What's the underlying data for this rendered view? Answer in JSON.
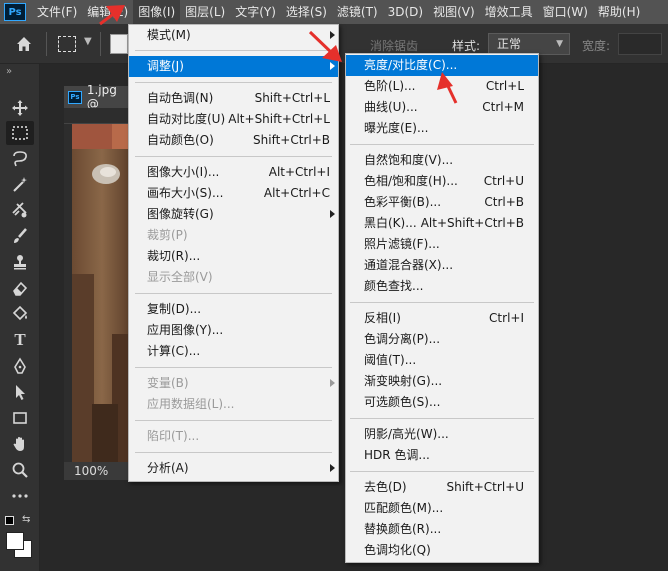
{
  "menubar": {
    "logo": "Ps",
    "items": [
      "文件(F)",
      "编辑(E)",
      "图像(I)",
      "图层(L)",
      "文字(Y)",
      "选择(S)",
      "滤镜(T)",
      "3D(D)",
      "视图(V)",
      "增效工具",
      "窗口(W)",
      "帮助(H)"
    ]
  },
  "options": {
    "antialias": "消除锯齿",
    "style_label": "样式:",
    "style_value": "正常",
    "width_label": "宽度:"
  },
  "document": {
    "tab_title": "1.jpg @",
    "zoom": "100%"
  },
  "image_menu": {
    "items": [
      {
        "label": "模式(M)",
        "shortcut": "",
        "submenu": true,
        "disabled": false
      },
      {
        "label": "调整(J)",
        "shortcut": "",
        "submenu": true,
        "disabled": false,
        "highlighted": true
      },
      {
        "label": "自动色调(N)",
        "shortcut": "Shift+Ctrl+L",
        "disabled": false
      },
      {
        "label": "自动对比度(U)",
        "shortcut": "Alt+Shift+Ctrl+L",
        "disabled": false
      },
      {
        "label": "自动颜色(O)",
        "shortcut": "Shift+Ctrl+B",
        "disabled": false
      },
      {
        "label": "图像大小(I)...",
        "shortcut": "Alt+Ctrl+I",
        "disabled": false
      },
      {
        "label": "画布大小(S)...",
        "shortcut": "Alt+Ctrl+C",
        "disabled": false
      },
      {
        "label": "图像旋转(G)",
        "shortcut": "",
        "submenu": true,
        "disabled": false
      },
      {
        "label": "裁剪(P)",
        "shortcut": "",
        "disabled": true
      },
      {
        "label": "裁切(R)...",
        "shortcut": "",
        "disabled": false
      },
      {
        "label": "显示全部(V)",
        "shortcut": "",
        "disabled": true
      },
      {
        "label": "复制(D)...",
        "shortcut": "",
        "disabled": false
      },
      {
        "label": "应用图像(Y)...",
        "shortcut": "",
        "disabled": false
      },
      {
        "label": "计算(C)...",
        "shortcut": "",
        "disabled": false
      },
      {
        "label": "变量(B)",
        "shortcut": "",
        "submenu": true,
        "disabled": true
      },
      {
        "label": "应用数据组(L)...",
        "shortcut": "",
        "disabled": true
      },
      {
        "label": "陷印(T)...",
        "shortcut": "",
        "disabled": true
      },
      {
        "label": "分析(A)",
        "shortcut": "",
        "submenu": true,
        "disabled": false
      }
    ]
  },
  "adjust_menu": {
    "items": [
      {
        "label": "亮度/对比度(C)...",
        "shortcut": "",
        "highlighted": true
      },
      {
        "label": "色阶(L)...",
        "shortcut": "Ctrl+L"
      },
      {
        "label": "曲线(U)...",
        "shortcut": "Ctrl+M"
      },
      {
        "label": "曝光度(E)...",
        "shortcut": ""
      },
      {
        "label": "自然饱和度(V)...",
        "shortcut": ""
      },
      {
        "label": "色相/饱和度(H)...",
        "shortcut": "Ctrl+U"
      },
      {
        "label": "色彩平衡(B)...",
        "shortcut": "Ctrl+B"
      },
      {
        "label": "黑白(K)...",
        "shortcut": "Alt+Shift+Ctrl+B"
      },
      {
        "label": "照片滤镜(F)...",
        "shortcut": ""
      },
      {
        "label": "通道混合器(X)...",
        "shortcut": ""
      },
      {
        "label": "颜色查找...",
        "shortcut": ""
      },
      {
        "label": "反相(I)",
        "shortcut": "Ctrl+I"
      },
      {
        "label": "色调分离(P)...",
        "shortcut": ""
      },
      {
        "label": "阈值(T)...",
        "shortcut": ""
      },
      {
        "label": "渐变映射(G)...",
        "shortcut": ""
      },
      {
        "label": "可选颜色(S)...",
        "shortcut": ""
      },
      {
        "label": "阴影/高光(W)...",
        "shortcut": ""
      },
      {
        "label": "HDR 色调...",
        "shortcut": ""
      },
      {
        "label": "去色(D)",
        "shortcut": "Shift+Ctrl+U"
      },
      {
        "label": "匹配颜色(M)...",
        "shortcut": ""
      },
      {
        "label": "替换颜色(R)...",
        "shortcut": ""
      },
      {
        "label": "色调均化(Q)",
        "shortcut": ""
      }
    ]
  },
  "colors": {
    "highlight": "#0078d7",
    "annotation_arrow": "#e5302b"
  }
}
